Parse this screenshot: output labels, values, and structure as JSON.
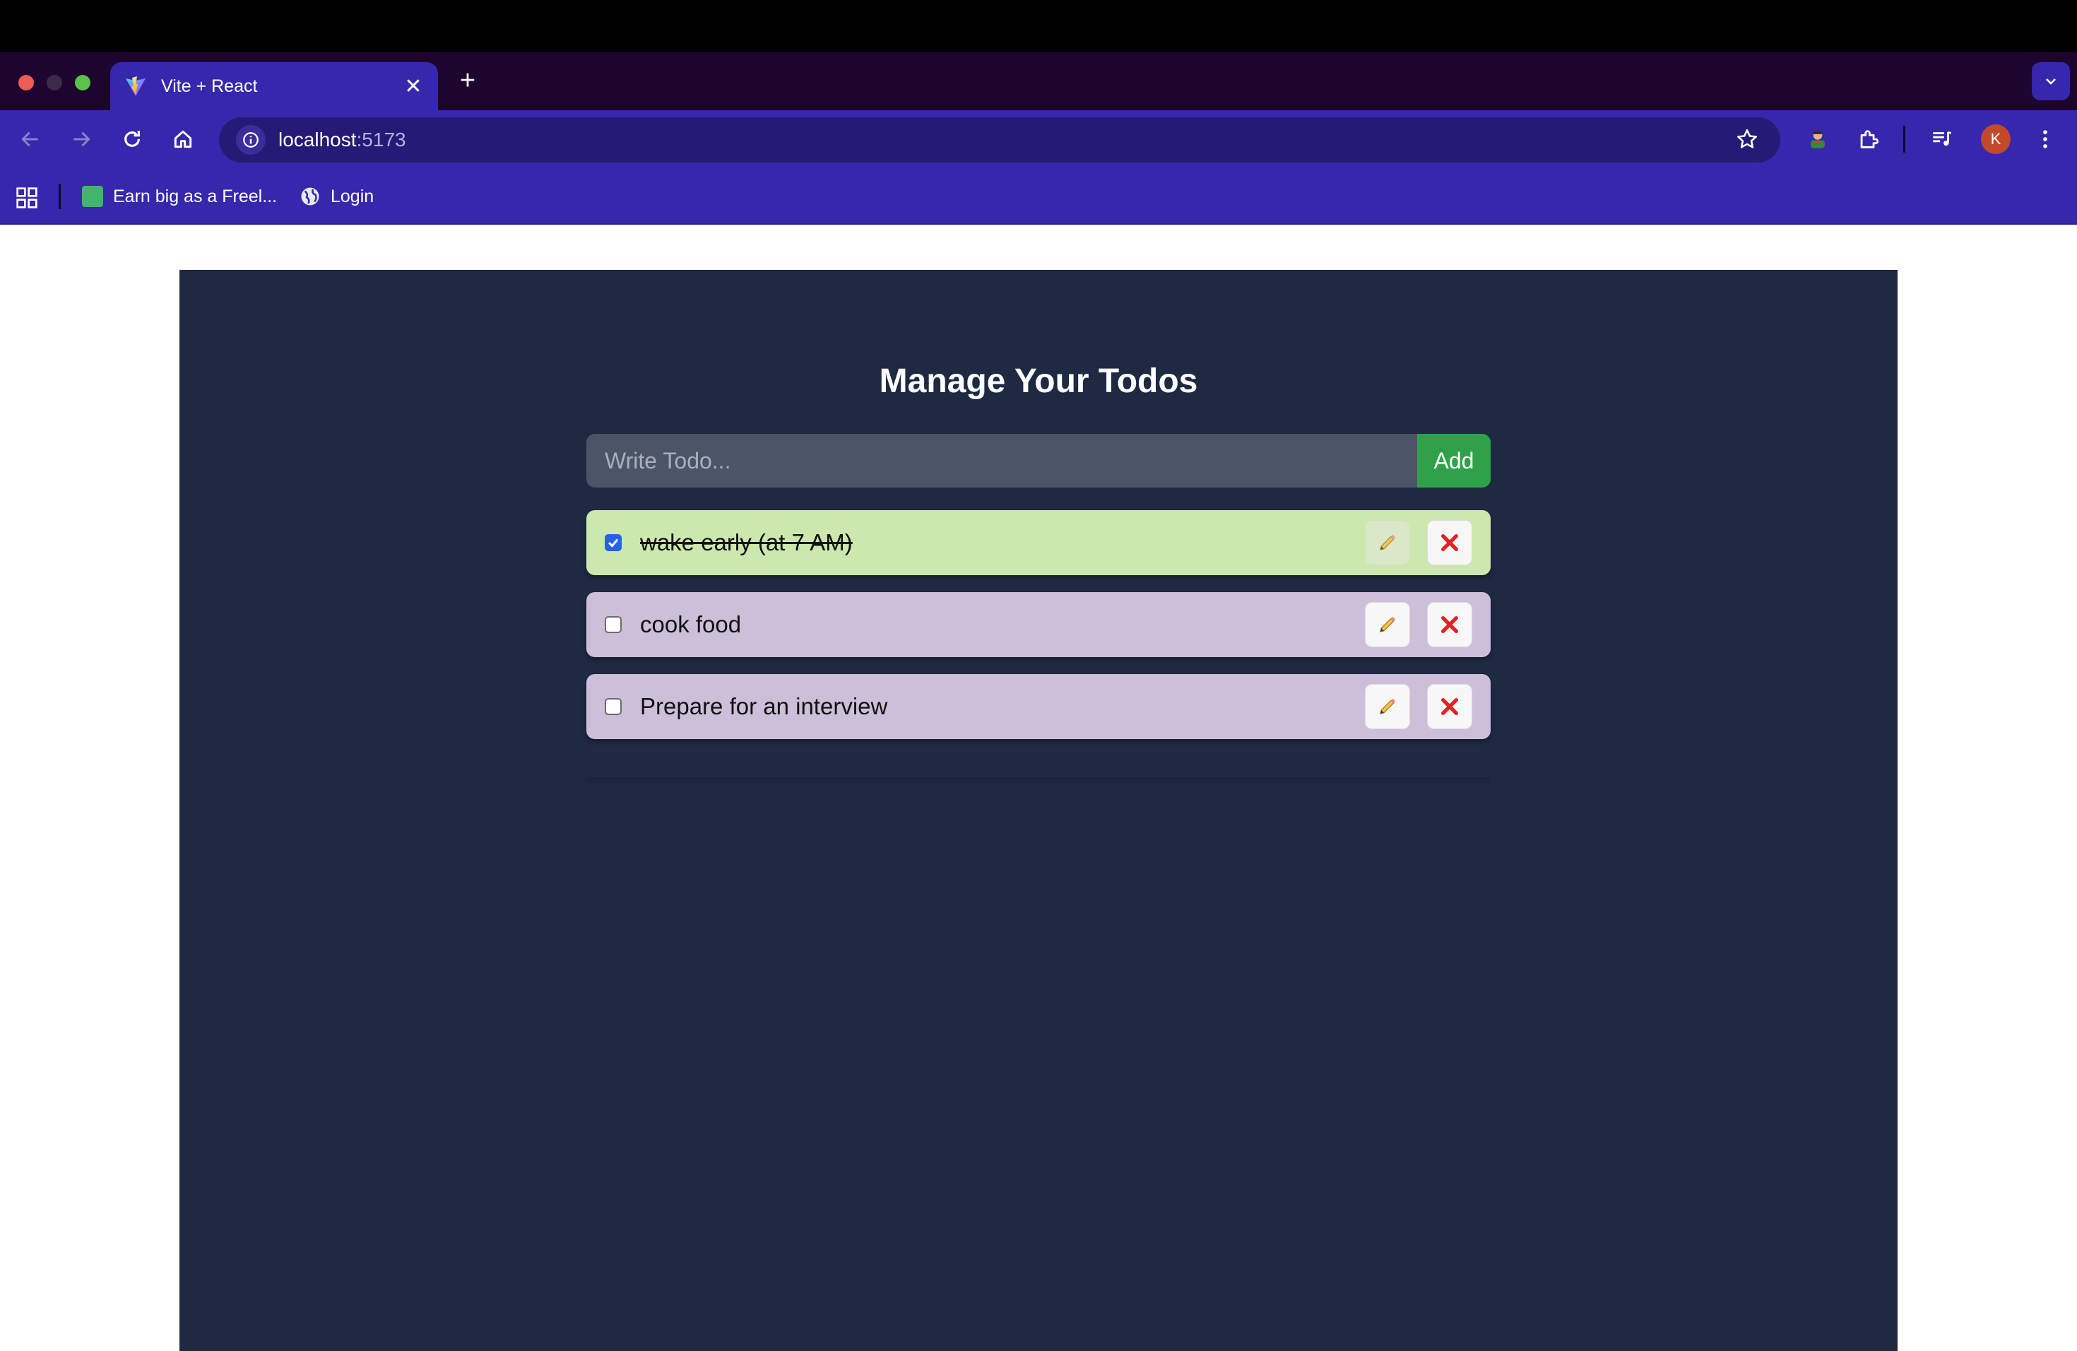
{
  "browser": {
    "tab_title": "Vite + React",
    "url_host": "localhost",
    "url_port": ":5173",
    "profile_initial": "K",
    "bookmarks": [
      {
        "label": "Earn big as a Freel..."
      },
      {
        "label": "Login"
      }
    ]
  },
  "app": {
    "title": "Manage Your Todos",
    "input_placeholder": "Write Todo...",
    "add_label": "Add",
    "todos": [
      {
        "text": "wake early (at 7 AM)",
        "completed": true
      },
      {
        "text": "cook food",
        "completed": false
      },
      {
        "text": "Prepare for an interview",
        "completed": false
      }
    ]
  },
  "colors": {
    "tab_active": "#3627ad",
    "app_background": "#1e2942",
    "add_button": "#2fa14a",
    "todo_done": "#cde8ae",
    "todo_open": "#cdbfd9",
    "delete_x": "#e02424"
  }
}
